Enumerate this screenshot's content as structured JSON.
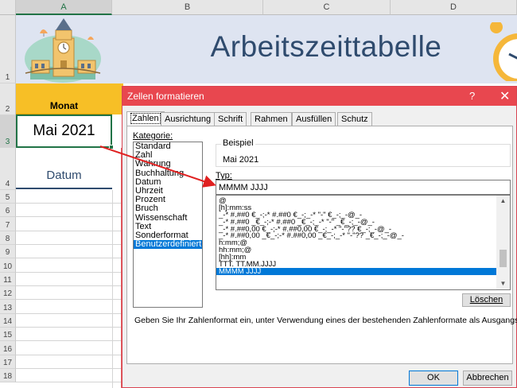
{
  "sheet": {
    "columns": [
      "A",
      "B",
      "C",
      "D"
    ],
    "rows": [
      "1",
      "2",
      "3",
      "4",
      "5",
      "6",
      "7",
      "8",
      "9",
      "10",
      "11",
      "12",
      "13",
      "14",
      "15",
      "16",
      "17",
      "18"
    ],
    "title": "Arbeitszeittabelle",
    "monat_header": "Monat",
    "month_value": "Mai 2021",
    "datum_header": "Datum"
  },
  "dialog": {
    "title": "Zellen formatieren",
    "help": "?",
    "close": "✕",
    "tabs": [
      "Zahlen",
      "Ausrichtung",
      "Schrift",
      "Rahmen",
      "Ausfüllen",
      "Schutz"
    ],
    "kategorie_label": "Kategorie:",
    "categories": [
      "Standard",
      "Zahl",
      "Währung",
      "Buchhaltung",
      "Datum",
      "Uhrzeit",
      "Prozent",
      "Bruch",
      "Wissenschaft",
      "Text",
      "Sonderformat",
      "Benutzerdefiniert"
    ],
    "selected_category": "Benutzerdefiniert",
    "beispiel_label": "Beispiel",
    "beispiel_value": "Mai 2021",
    "typ_label": "Typ:",
    "typ_value": "MMMM JJJJ",
    "formats": [
      "@",
      "[h]:mm:ss",
      "_-* #.##0 €_-;-* #.##0 €_-;_-* \"-\" €_-;_-@_-",
      "_-* #.##0 _€_-;-* #.##0 _€_-;_-* \"-\" _€_-;_-@_-",
      "_-* #.##0,00 €_-;-* #.##0,00 €_-;_-* \"-\"?? €_-;_-@_-",
      "_-* #.##0,00 _€_-;-* #.##0,00 _€_-;_-* \"-\"?? _€_-;_-@_-",
      "h:mm;@",
      "hh:mm;@",
      "[hh]:mm",
      "TTT. TT.MM.JJJJ",
      "MMMM JJJJ"
    ],
    "selected_format": "MMMM JJJJ",
    "delete_label": "Löschen",
    "hint": "Geben Sie Ihr Zahlenformat ein, unter Verwendung eines der bestehenden Zahlenformate als Ausgangspunkt.",
    "ok_label": "OK",
    "cancel_label": "Abbrechen"
  },
  "colors": {
    "accent": "#e8474f",
    "selection": "#0078d7",
    "header_yellow": "#f7bf26",
    "title_blue": "#2f4b6e",
    "annotation_arrow": "#e02020"
  }
}
